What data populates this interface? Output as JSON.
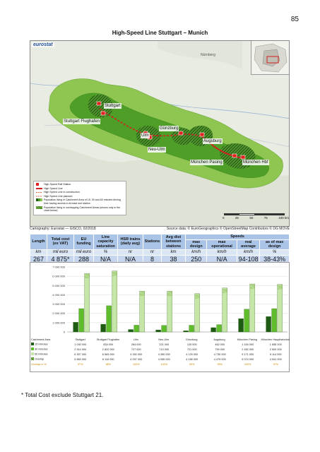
{
  "page": {
    "number": "85",
    "title": "High-Speed Line Stuttgart – Munich"
  },
  "map": {
    "logo": "eurostat",
    "places": {
      "nurnberg": "Nürnberg",
      "stuttgart": "Stuttgart",
      "flughafen": "Stuttgart Flughafen",
      "ulm": "Ulm",
      "gunzburg": "Günzburg",
      "augsburg": "Augsburg",
      "neu_ulm": "Neu-Ulm",
      "pasing": "München Pasing",
      "hbf": "München Hbf"
    },
    "legend": [
      {
        "label": "High-Speed Rail Station",
        "color": "#e0201c",
        "kind": "station"
      },
      {
        "label": "High Speed Line",
        "color": "#d42020",
        "kind": "line"
      },
      {
        "label": "High Speed Line in construction",
        "color": "#e06a3a",
        "kind": "dash"
      },
      {
        "label": "High Speed Line planned",
        "color": "#f2b6a6",
        "kind": "dash"
      },
      {
        "label": "Population living in Catchment Area of 15, 30 and 60 minutes driving time having access to at least one station",
        "color": "#3d8a1e",
        "kind": "area"
      },
      {
        "label": "Population living in overlapping Catchment Areas (shown only in the chart below)",
        "color": "#9acd5a",
        "kind": "hatch"
      }
    ],
    "scale_labels": [
      "0",
      "25",
      "50",
      "75",
      "100 km"
    ],
    "credit_left": "Cartography: Eurostat — GISCO, 02/2018",
    "credit_right": "Source data: © EuroGeographics © OpenStreetMap Contributors © DG MOVE"
  },
  "specs": {
    "headers": {
      "length": "Length",
      "total_cost": "Total cost (ex VAT)",
      "eu_funding": "EU funding",
      "line_capacity": "Line capacity saturation",
      "hsr_trains": "HSR trains (daily avg)",
      "stations": "Stations",
      "avg_dist": "Avg dist between stations",
      "speeds": "Speeds",
      "max_design": "max design",
      "max_operational": "max operational",
      "real_average": "real average",
      "as_of_max": "as of max design"
    },
    "units": [
      "km",
      "mil euro",
      "mil euro",
      "%",
      "nr",
      "nr",
      "km",
      "km/h",
      "km/h",
      "km/h",
      "%"
    ],
    "values": [
      "267",
      "4 875*",
      "288",
      "N/A",
      "N/A",
      "8",
      "38",
      "250",
      "N/A",
      "94-108",
      "38-43%"
    ]
  },
  "chart_data": {
    "type": "bar",
    "title": "",
    "xlabel": "",
    "ylabel": "",
    "ylim": [
      0,
      7000000
    ],
    "yticks": [
      "0",
      "1 000 000",
      "2 000 000",
      "3 000 000",
      "4 000 000",
      "5 000 000",
      "6 000 000",
      "7 000 000"
    ],
    "categories": [
      "Stuttgart",
      "Stuttgart Flughafen",
      "Ulm",
      "Neu-Ulm",
      "Günzburg",
      "Augsburg",
      "München Pasing",
      "München Hauptbahnhof"
    ],
    "series": [
      {
        "name": "15 minutes",
        "color": "#1e5c14",
        "values": [
          1040000,
          834000,
          264000,
          221000,
          125000,
          462000,
          1434000,
          1655000
        ]
      },
      {
        "name": "30 minutes",
        "color": "#5fbd2c",
        "values": [
          2510000,
          2822000,
          727000,
          710000,
          721000,
          790000,
          2452000,
          2509000
        ]
      },
      {
        "name": "60 minutes",
        "color": "#c6e6a8",
        "values": [
          6307000,
          6563000,
          4392000,
          4390000,
          4129000,
          4730000,
          5171000,
          5114000
        ]
      }
    ],
    "overlap": {
      "name": "Overlap",
      "values": [
        "5 863 000",
        "6 116 000",
        "4 097 000",
        "4 095 000",
        "4 156 000",
        "4 479 000",
        "5 074 000",
        "4 941 000"
      ]
    },
    "overlap_pct": {
      "name": "Overlap in %",
      "values": [
        "97%",
        "98%",
        "100%",
        "100%",
        "99%",
        "99%",
        "100%",
        "97%"
      ]
    },
    "table_header": "Catchment Area",
    "table_rows": [
      {
        "label": "15 minutes",
        "values": [
          "1 040 000",
          "834 000",
          "264 000",
          "221 000",
          "125 000",
          "462 000",
          "1 434 000",
          "1 655 000"
        ]
      },
      {
        "label": "30 minutes",
        "values": [
          "2 510 000",
          "2 822 000",
          "727 000",
          "710 000",
          "721 000",
          "790 000",
          "2 452 000",
          "2 509 000"
        ]
      },
      {
        "label": "60 minutes",
        "values": [
          "6 307 000",
          "6 563 000",
          "4 392 000",
          "4 390 000",
          "4 129 000",
          "4 730 000",
          "5 171 000",
          "5 114 000"
        ]
      }
    ],
    "grid": true,
    "legend": "bottom-table"
  },
  "footnote": "* Total Cost exclude Stuttgart 21."
}
